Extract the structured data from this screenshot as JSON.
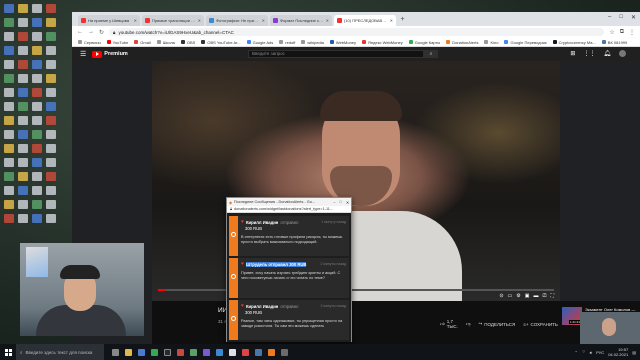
{
  "browser": {
    "tabs": [
      {
        "label": "На приеме у Шевцова"
      },
      {
        "label": "Прямые трансляции - YouTube"
      },
      {
        "label": "Фотографии: Не приеме у Шевц..."
      },
      {
        "label": "Формат Последние сообщения"
      },
      {
        "label": "(10) ПРЕСЛЕДОВАВШИЙ МЕ..."
      }
    ],
    "url": "youtube.com/watch?v=iUlGAS9HxeU&ab_channel=CTAC",
    "bookmarks": [
      "Сервисы",
      "YouTube",
      "Gmail",
      "Школа",
      "OBS",
      "OBS YouTube Ar...",
      "Google Ads",
      "redoff",
      "wikipedia",
      "WebMoney",
      "Яндекс WebMoney",
      "Google Карты",
      "DonationAlerts",
      "Kino",
      "Google Переводчик",
      "Cryptocurrency Ma...",
      "ВК 081999"
    ]
  },
  "youtube": {
    "logo_text": "Premium",
    "search_placeholder": "Введите запрос",
    "video_title": "ИЙ МЕНЯ ИВАНОВ ТЕПЕРЬ В ПО...",
    "video_date": "31 янв. 2021 г.",
    "likes": "1,7 ТЫС.",
    "share_label": "ПОДЕЛИТЬСЯ",
    "save_label": "СОХРАНИТЬ",
    "progress": 0.02,
    "rec": {
      "title": "Экзамент Олег Комолов — Илон Маск (прими...",
      "channel": "ФД Еще Просто!",
      "views": "595 тыс. просмотров",
      "age": "5 месяцев назад",
      "duration": "1:21:21"
    }
  },
  "popup": {
    "window_title": "Последние Сообщения - DonationAlerts - Go...",
    "url": "donationalerts.com/widget/lastdonations?alert_type=1-11...",
    "cards": [
      {
        "name": "Кирилл Ивадин",
        "verb": "отправил",
        "time": "1 минуту назад",
        "amount": "300 RUB",
        "message": "В интернетах есть готовые профили раскроя, ты можешь просто выбрать максимально подходящий."
      },
      {
        "name": "Штрудель отправил 300 RUB",
        "verb": "",
        "time": "2 минуты назад",
        "amount": "",
        "message": "Привет, хочу начать изучать трейдинг крипты и акций. С чего посоветуешь начать и что читать по теме?"
      },
      {
        "name": "Кирилл Ивадин",
        "verb": "отправил",
        "time": "2 минуты назад",
        "amount": "300 RUB",
        "message": "Разные, там чаты одинаковые, ты упрощенная просто на заводе рокостоли. Ты сам это можешь сделать"
      }
    ]
  },
  "taskbar": {
    "search_placeholder": "Введите здесь текст для поиска",
    "lang": "РУС",
    "time": "19:57",
    "date": "04.02.2021"
  },
  "colors": {
    "accent": "#ff0000",
    "donation_orange": "#f07b1e",
    "highlight": "#3a7bd5"
  }
}
